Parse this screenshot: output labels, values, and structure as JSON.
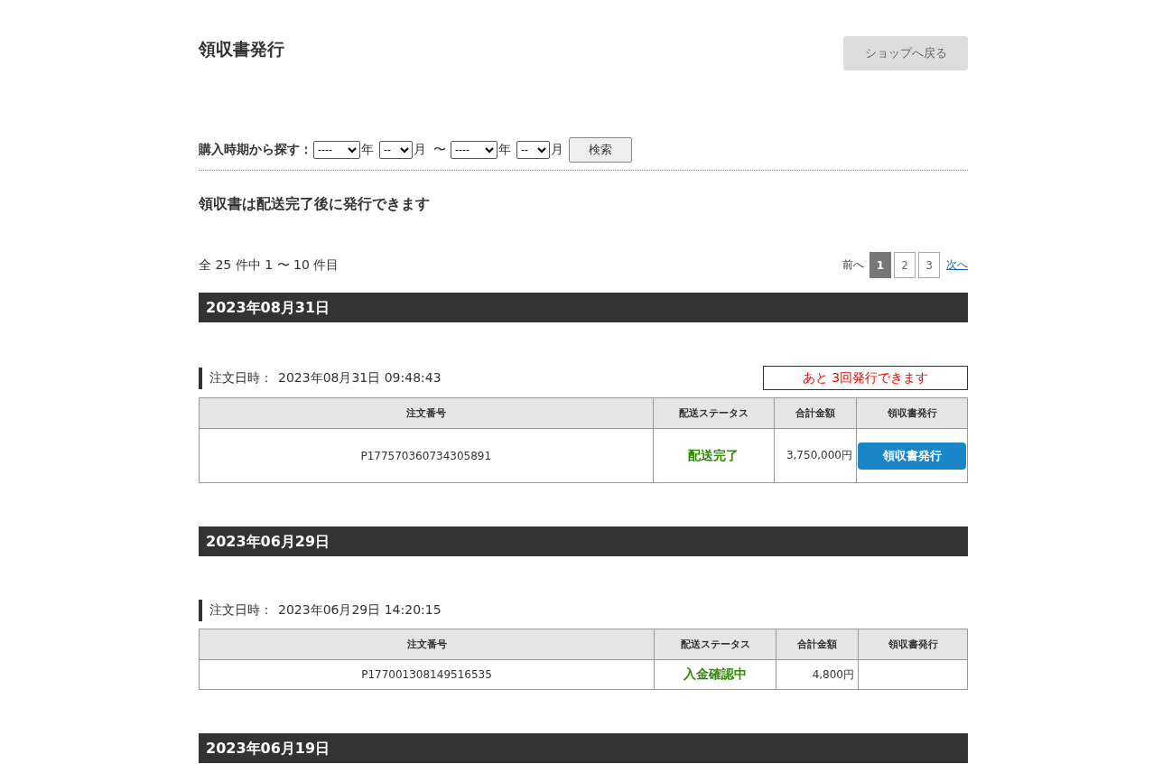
{
  "page_title": "領収書発行",
  "back_button": "ショップへ戻る",
  "search": {
    "label": "購入時期から探す：",
    "from_year": "----",
    "year_unit_1": "年",
    "from_month": "--",
    "month_unit_1": "月",
    "tilde": "〜",
    "to_year": "----",
    "year_unit_2": "年",
    "to_month": "--",
    "month_unit_2": "月",
    "button": "検索"
  },
  "notice": "領収書は配送完了後に発行できます",
  "count_text": "全 25 件中 1 〜 10 件目",
  "pagination": {
    "prev": "前へ",
    "pages": [
      {
        "label": "1",
        "selected": true
      },
      {
        "label": "2",
        "selected": false
      },
      {
        "label": "3",
        "selected": false
      }
    ],
    "next": "次へ"
  },
  "groups": [
    {
      "date": "2023年08月31日",
      "order_label": "注文日時：",
      "order_datetime": "2023年08月31日 09:48:43",
      "remaining": "あと 3回発行できます",
      "columns": [
        "注文番号",
        "配送ステータス",
        "合計金額",
        "領収書発行"
      ],
      "rows": [
        {
          "order_no": "P177570360734305891",
          "status": "配送完了",
          "total": "3,750,000円",
          "receipt_button": "領収書発行"
        }
      ]
    },
    {
      "date": "2023年06月29日",
      "order_label": "注文日時：",
      "order_datetime": "2023年06月29日 14:20:15",
      "columns": [
        "注文番号",
        "配送ステータス",
        "合計金額",
        "領収書発行"
      ],
      "rows": [
        {
          "order_no": "P177001308149516535",
          "status": "入金確認中",
          "total": "4,800円"
        }
      ]
    },
    {
      "date": "2023年06月19日"
    }
  ]
}
